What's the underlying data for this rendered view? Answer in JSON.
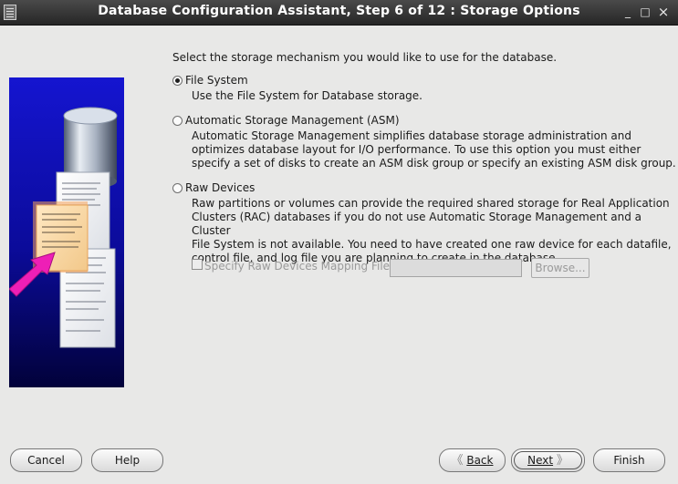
{
  "window": {
    "title": "Database Configuration Assistant, Step 6 of 12 : Storage Options",
    "minimize_glyph": "_",
    "maximize_glyph": "□",
    "close_glyph": "×"
  },
  "icons": {
    "app": "app-menu-icon",
    "illustration": "database-with-documents-illustration"
  },
  "main": {
    "prompt": "Select the storage mechanism you would like to use for the database.",
    "options": [
      {
        "label": "File System",
        "checked": true,
        "description": "Use the File System for Database storage."
      },
      {
        "label": "Automatic Storage Management (ASM)",
        "checked": false,
        "description": "Automatic Storage Management simplifies database storage administration and\noptimizes database layout for I/O performance. To use this option you must either\nspecify a set of disks to create an ASM disk group or specify an existing ASM disk group."
      },
      {
        "label": "Raw Devices",
        "checked": false,
        "description": "Raw partitions or volumes can provide the required shared storage for Real Application\nClusters (RAC) databases if you do not use Automatic Storage Management and a Cluster\nFile System is not available.  You need to have created one raw device for each datafile,\ncontrol file, and log file you are planning to create in the database."
      }
    ],
    "raw_mapping": {
      "label": "Specify Raw Devices Mapping File",
      "checked": false,
      "enabled": false,
      "value": "",
      "browse_label": "Browse..."
    }
  },
  "footer": {
    "cancel": "Cancel",
    "help": "Help",
    "back": "Back",
    "next": "Next",
    "finish": "Finish",
    "back_chevron": "《",
    "next_chevron": "》"
  },
  "colors": {
    "titlebar": "#2e2e2e",
    "background": "#e8e8e7",
    "illustration_blue": "#1515c8",
    "arrow_magenta": "#ee1fb6"
  }
}
